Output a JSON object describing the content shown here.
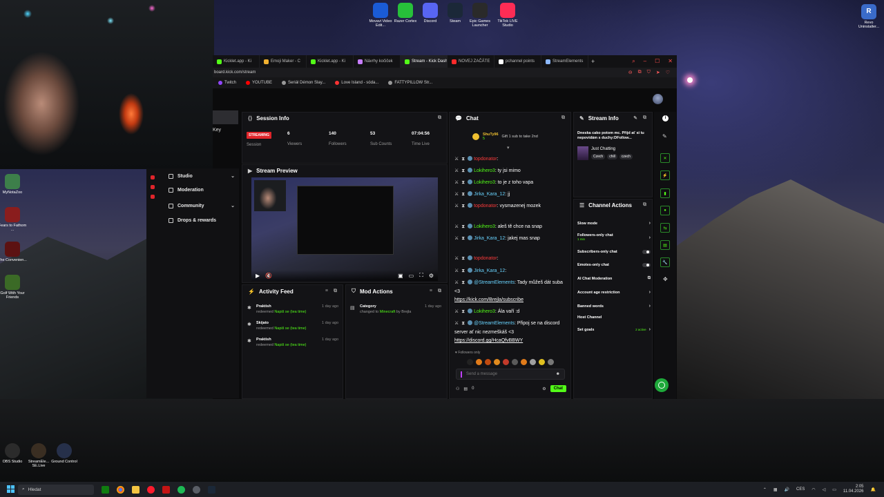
{
  "desktop": {
    "top_icons": [
      {
        "label": "Movavi Video Edit...",
        "color": "#1a5bd6"
      },
      {
        "label": "Razer Cortex",
        "color": "#27c03a"
      },
      {
        "label": "Discord",
        "color": "#5865f2"
      },
      {
        "label": "Steam",
        "color": "#1b2838"
      },
      {
        "label": "Epic Games Launcher",
        "color": "#2a2a2a"
      },
      {
        "label": "TikTok LIVE Studio",
        "color": "#fe2c55"
      }
    ],
    "top_right_icon": "Revo Uninstaller...",
    "left_icons": [
      {
        "label": "MyNotaZoo",
        "color": "#3d7f4a"
      },
      {
        "label": "Fears to Fathom ...",
        "color": "#8a1d1d"
      },
      {
        "label": "The Convenien...",
        "color": "#5c1212"
      },
      {
        "label": "Golf With Your Friends",
        "color": "#3b6a26"
      }
    ],
    "bottom_icons": [
      {
        "label": "OBS Studio",
        "color": "#2b2b2b"
      },
      {
        "label": "StreamEle... SE.Live",
        "color": "#3a2e22"
      },
      {
        "label": "Ground Control",
        "color": "#26304a"
      }
    ]
  },
  "browser": {
    "tabs": [
      {
        "label": "Kicklet.app - Ki",
        "color": "#53fc18",
        "active": false
      },
      {
        "label": "Emoji Maker - C",
        "color": "#f0b030",
        "active": false
      },
      {
        "label": "Kicklet.app - Ki",
        "color": "#53fc18",
        "active": false
      },
      {
        "label": "Návrhy kočiček",
        "color": "#c77dff",
        "active": false
      },
      {
        "label": "Stream - Kick Dashboard",
        "color": "#53fc18",
        "active": true
      },
      {
        "label": "NOVEJ ZAČÁTE",
        "color": "#ff2a2a",
        "active": false
      },
      {
        "label": "pchannel points",
        "color": "#ffffff",
        "active": false
      },
      {
        "label": "StreamElements",
        "color": "#8db8ff",
        "active": false
      }
    ],
    "url": "board.kick.com/stream",
    "bookmarks": [
      {
        "label": "Twitch",
        "color": "#9146ff"
      },
      {
        "label": "YOUTUBE",
        "color": "#ff0000"
      },
      {
        "label": "Seriál Démon Slay...",
        "color": "#999999"
      },
      {
        "label": "Love Island - sóda...",
        "color": "#ff3333"
      },
      {
        "label": "FATTYPILLOW Str...",
        "color": "#999999"
      }
    ]
  },
  "sidebar": {
    "key_label": "Key",
    "items": [
      {
        "label": "Studio",
        "has_chevron": true
      },
      {
        "label": "Moderation",
        "has_chevron": false
      },
      {
        "label": "Community",
        "has_chevron": true
      },
      {
        "label": "Drops & rewards",
        "has_chevron": false
      }
    ]
  },
  "session_info": {
    "title": "Session Info",
    "status_badge": "STREAMING",
    "status_label": "Session",
    "stats": [
      {
        "value": "6",
        "label": "Viewers"
      },
      {
        "value": "140",
        "label": "Followers"
      },
      {
        "value": "53",
        "label": "Sub Counts"
      },
      {
        "value": "07:04:56",
        "label": "Time Live"
      }
    ]
  },
  "stream_preview": {
    "title": "Stream Preview"
  },
  "activity_feed": {
    "title": "Activity Feed",
    "rows": [
      {
        "name": "Praktish",
        "action": "redeemed",
        "reward": "Napiš se (tea time)",
        "time": "1 day ago"
      },
      {
        "name": "Skijato",
        "action": "redeemed",
        "reward": "Napiš se (tea time)",
        "time": "1 day ago"
      },
      {
        "name": "Praktish",
        "action": "redeemed",
        "reward": "Napiš se (tea time)",
        "time": "1 day ago"
      }
    ]
  },
  "mod_actions": {
    "title": "Mod Actions",
    "rows": [
      {
        "name": "Category",
        "action": "changed to",
        "target": "Minecraft",
        "by": "by Brejla",
        "time": "1 day ago"
      }
    ]
  },
  "chat": {
    "title": "Chat",
    "pinned_user": "ShuTy96",
    "pinned_sub": "5",
    "pinned_text": "Gift 1 sub to take 2nd",
    "messages": [
      {
        "user": "topdonator",
        "color": "u-red",
        "text": ""
      },
      {
        "user": "Lokihero3",
        "color": "u-green",
        "text": "ty jsi mimo"
      },
      {
        "user": "Lokihero3",
        "color": "u-green",
        "text": "to je z toho vapa"
      },
      {
        "user": "Jirka_Kara_12",
        "color": "u-cyan",
        "text": "jj"
      },
      {
        "user": "topdonator",
        "color": "u-red",
        "text": "vysmazenej mozek"
      },
      {
        "user": "Lokihero3",
        "color": "u-green",
        "text": "aleš tě chce na snap"
      },
      {
        "user": "Jirka_Kara_12",
        "color": "u-cyan",
        "text": "jakej mas snap"
      },
      {
        "user": "topdonator",
        "color": "u-red",
        "text": ""
      },
      {
        "user": "Jirka_Kara_12",
        "color": "u-cyan",
        "text": ""
      },
      {
        "user": "@StreamElements",
        "color": "u-cyan",
        "text": "Tady můžeš dát suba <3",
        "link": "https://kick.com/Brejla/subscribe"
      },
      {
        "user": "Lokihero3",
        "color": "u-green",
        "text": "Ála vaří :d"
      },
      {
        "user": "@StreamElements",
        "color": "u-cyan",
        "text": "Připoj se na discord server ať nic nezmeškáš <3",
        "link": "https://discord.gg/HcaQfvBBWY"
      }
    ],
    "followers_only": "Followers only",
    "input_placeholder": "Send a message",
    "send_label": "Chat",
    "points": "0"
  },
  "stream_info": {
    "title": "Stream Info",
    "description": "Dneska cako potom mc. Přijd ať si tu nepovidám s duchy:DFollow...",
    "category": "Just Chatting",
    "tags": [
      "Czech",
      "chill",
      "czech"
    ]
  },
  "channel_actions": {
    "title": "Channel Actions",
    "rows": [
      {
        "label": "Slow mode",
        "control": "chevron",
        "sub": ""
      },
      {
        "label": "Followers-only chat",
        "control": "chevron",
        "sub": "1 min"
      },
      {
        "label": "Subscribers-only chat",
        "control": "toggle",
        "sub": ""
      },
      {
        "label": "Emotes-only chat",
        "control": "toggle",
        "sub": ""
      },
      {
        "label": "AI Chat Moderation",
        "control": "external",
        "sub": ""
      },
      {
        "label": "Account age restriction",
        "control": "chevron",
        "sub": ""
      },
      {
        "label": "Banned words",
        "control": "chevron",
        "sub": ""
      },
      {
        "label": "Host Channel",
        "control": "none",
        "sub": ""
      },
      {
        "label": "Set goals",
        "control": "chevron",
        "sub": "2 active"
      }
    ]
  },
  "taskbar": {
    "search_placeholder": "Hledat",
    "language": "CES",
    "time": "2:05",
    "date": "11.04.2026"
  },
  "colors": {
    "kick_green": "#53fc18",
    "panel_bg": "#131316",
    "streaming_red": "#e0252b"
  }
}
